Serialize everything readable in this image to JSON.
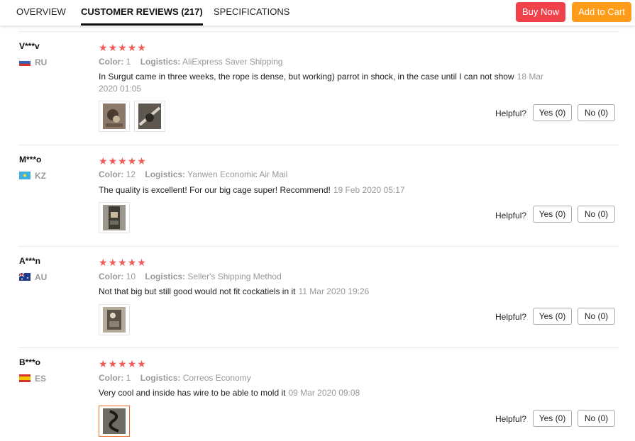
{
  "tabs": {
    "overview": "OVERVIEW",
    "reviews": "CUSTOMER REVIEWS (217)",
    "specifications": "SPECIFICATIONS"
  },
  "actions": {
    "buy_now": "Buy Now",
    "add_to_cart": "Add to Cart"
  },
  "labels": {
    "color": "Color:",
    "logistics": "Logistics:",
    "helpful": "Helpful?"
  },
  "reviews": [
    {
      "user": "V***v",
      "country": "RU",
      "rating": 5,
      "color": "1",
      "logistics": "AliExpress Saver Shipping",
      "text": "In Surgut came in three weeks, the rope is dense, but working) parrot in shock, in the case until I can not show",
      "date": "18 Mar 2020 01:05",
      "yes": "Yes (0)",
      "no": "No (0)"
    },
    {
      "user": "M***o",
      "country": "KZ",
      "rating": 5,
      "color": "12",
      "logistics": "Yanwen Economic Air Mail",
      "text": "The quality is excellent! For our big cage super! Recommend!",
      "date": "19 Feb 2020 05:17",
      "yes": "Yes (0)",
      "no": "No (0)"
    },
    {
      "user": "A***n",
      "country": "AU",
      "rating": 5,
      "color": "10",
      "logistics": "Seller's Shipping Method",
      "text": "Not that big but still good would not fit cockatiels in it",
      "date": "11 Mar 2020 19:26",
      "yes": "Yes (0)",
      "no": "No (0)"
    },
    {
      "user": "B***o",
      "country": "ES",
      "rating": 5,
      "color": "1",
      "logistics": "Correos Economy",
      "text": "Very cool and inside has wire to be able to mold it",
      "date": "09 Mar 2020 09:08",
      "yes": "Yes (0)",
      "no": "No (0)"
    }
  ],
  "colors": {
    "buy_now": "#f0424b",
    "add_to_cart": "#ff9c1a",
    "star": "#f05b57",
    "selected_thumb": "#f06a28"
  }
}
